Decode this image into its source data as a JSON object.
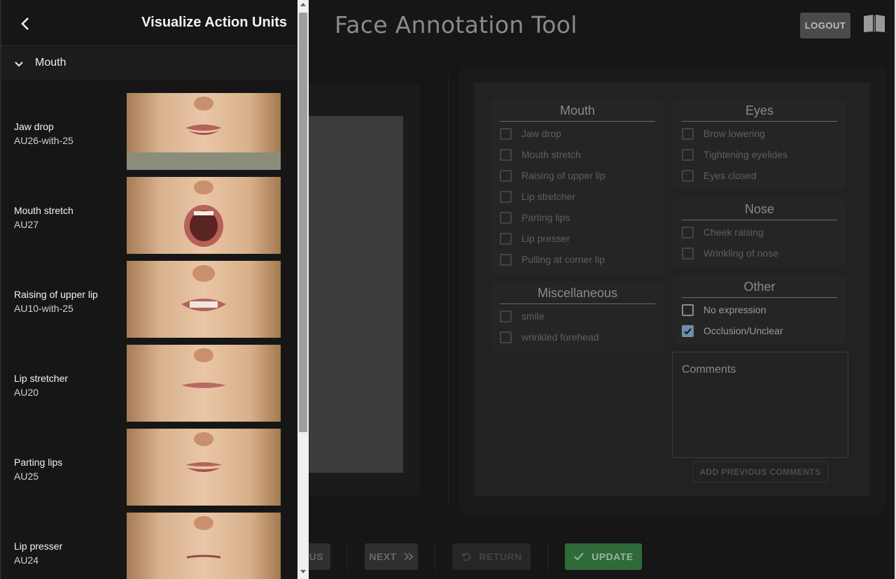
{
  "app": {
    "title": "Face Annotation Tool",
    "logout_label": "LOGOUT"
  },
  "form": {
    "groups": {
      "mouth": {
        "title": "Mouth",
        "items": [
          {
            "label": "Jaw drop",
            "checked": false
          },
          {
            "label": "Mouth stretch",
            "checked": false
          },
          {
            "label": "Raising of upper lip",
            "checked": false
          },
          {
            "label": "Lip stretcher",
            "checked": false
          },
          {
            "label": "Parting lips",
            "checked": false
          },
          {
            "label": "Lip presser",
            "checked": false
          },
          {
            "label": "Pulling at corner lip",
            "checked": false
          }
        ]
      },
      "eyes": {
        "title": "Eyes",
        "items": [
          {
            "label": "Brow lowering",
            "checked": false
          },
          {
            "label": "Tightening eyelides",
            "checked": false
          },
          {
            "label": "Eyes closed",
            "checked": false
          }
        ]
      },
      "nose": {
        "title": "Nose",
        "items": [
          {
            "label": "Cheek raising",
            "checked": false
          },
          {
            "label": "Wrinkling of nose",
            "checked": false
          }
        ]
      },
      "misc": {
        "title": "Miscellaneous",
        "items": [
          {
            "label": "smile",
            "checked": false
          },
          {
            "label": "wrinkled forehead",
            "checked": false
          }
        ]
      },
      "other": {
        "title": "Other",
        "items": [
          {
            "label": "No expression",
            "checked": false
          },
          {
            "label": "Occlusion/Unclear",
            "checked": true
          }
        ]
      }
    },
    "comments_placeholder": "Comments",
    "add_previous_label": "ADD PREVIOUS COMMENTS"
  },
  "bottom": {
    "prev_label": "OUS",
    "next_label": "NEXT",
    "return_label": "RETURN",
    "update_label": "UPDATE"
  },
  "drawer": {
    "title": "Visualize Action Units",
    "section": "Mouth",
    "items": [
      {
        "name": "Jaw drop",
        "code": "AU26-with-25"
      },
      {
        "name": "Mouth stretch",
        "code": "AU27"
      },
      {
        "name": "Raising of upper lip",
        "code": "AU10-with-25"
      },
      {
        "name": "Lip stretcher",
        "code": "AU20"
      },
      {
        "name": "Parting lips",
        "code": "AU25"
      },
      {
        "name": "Lip presser",
        "code": "AU24"
      }
    ]
  },
  "colors": {
    "accent_check": "#6f8bb0",
    "update_green": "#2f6b39"
  }
}
